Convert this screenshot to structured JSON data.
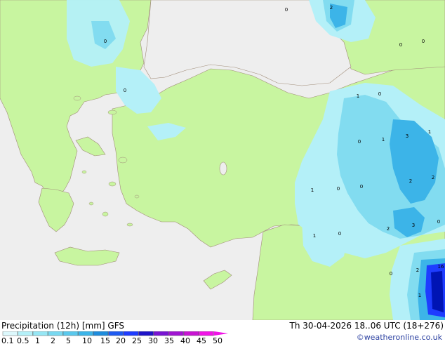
{
  "map": {
    "colors": {
      "sea": "#eeeeee",
      "land": "#c8f5a0",
      "precip_light": "#b4f0f8",
      "precip_medium": "#82dcf0",
      "precip_heavy": "#3cb4e8",
      "precip_very_heavy": "#1e3cff",
      "precip_extreme": "#0014b4",
      "coast": "#a08c78"
    },
    "value_labels": [
      "2",
      "0",
      "0",
      "0",
      "0",
      "0",
      "1",
      "0",
      "0",
      "1",
      "3",
      "1",
      "2",
      "2",
      "1",
      "0",
      "0",
      "1",
      "0",
      "2",
      "3",
      "0",
      "2",
      "0",
      "16",
      "1"
    ]
  },
  "legend": {
    "title": "Precipitation (12h) [mm] GFS",
    "valid_time": "Th 30-04-2026 18..06 UTC (18+276)",
    "credit": "©weatheronline.co.uk",
    "ticks": [
      "0.1",
      "0.5",
      "1",
      "2",
      "5",
      "10",
      "15",
      "20",
      "25",
      "30",
      "35",
      "40",
      "45",
      "50"
    ],
    "colors": [
      "#dcf8fc",
      "#b4f0f8",
      "#96e6f4",
      "#78d8f0",
      "#5ac8ec",
      "#3cb4e8",
      "#1e8cdc",
      "#1e5af0",
      "#1e3cff",
      "#1e14c8",
      "#7814d2",
      "#a014d2",
      "#c814d2",
      "#f014e6"
    ]
  }
}
